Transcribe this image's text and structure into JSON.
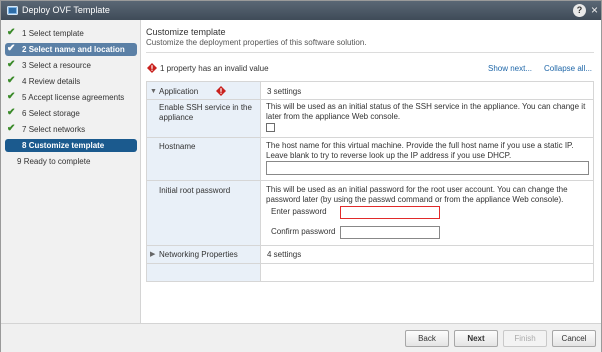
{
  "window": {
    "title": "Deploy OVF Template",
    "help_label": "?",
    "close_label": "×",
    "icon": "vm-deploy-icon"
  },
  "sidebar": {
    "steps": [
      {
        "number": "1",
        "label": "Select template",
        "completed": true
      },
      {
        "number": "2",
        "label": "Select name and location",
        "completed": true
      },
      {
        "number": "3",
        "label": "Select a resource",
        "completed": true
      },
      {
        "number": "4",
        "label": "Review details",
        "completed": true
      },
      {
        "number": "5",
        "label": "Accept license agreements",
        "completed": true
      },
      {
        "number": "6",
        "label": "Select storage",
        "completed": true
      },
      {
        "number": "7",
        "label": "Select networks",
        "completed": true
      },
      {
        "number": "8",
        "label": "Customize template",
        "completed": false
      },
      {
        "number": "9",
        "label": "Ready to complete",
        "completed": false
      }
    ],
    "check_glyph": "✔",
    "selected_step": "2",
    "current_step": "8"
  },
  "main": {
    "title": "Customize template",
    "subtitle": "Customize the deployment properties of this software solution.",
    "warning": "1 property has an invalid value",
    "show_next": "Show next...",
    "collapse_all": "Collapse all...",
    "groups": [
      {
        "label": "Application",
        "value": "3 settings",
        "expanded": true,
        "invalid": true,
        "properties": [
          {
            "label": "Enable SSH service in the appliance",
            "description": "This will be used as an initial status of the SSH service in the appliance. You can change it later from the appliance Web console.",
            "control": "checkbox"
          },
          {
            "label": "Hostname",
            "description": "The host name for this virtual machine. Provide the full host name if you use a static IP. Leave blank to try to reverse look up the IP address if you use DHCP.",
            "control": "text",
            "value": ""
          },
          {
            "label": "Initial root password",
            "description": "This will be used as an initial password for the root user account. You can change the password later (by using the passwd command or from the appliance Web console).",
            "control": "password",
            "fields": [
              {
                "label": "Enter password",
                "value": "",
                "invalid": true
              },
              {
                "label": "Confirm password",
                "value": "",
                "invalid": false
              }
            ]
          }
        ]
      },
      {
        "label": "Networking Properties",
        "value": "4 settings",
        "expanded": false,
        "invalid": false
      }
    ]
  },
  "footer": {
    "back": "Back",
    "next": "Next",
    "finish": "Finish",
    "cancel": "Cancel"
  },
  "colors": {
    "titlebar": "#4a5664",
    "sidebar_bg": "#f1f1f1",
    "selected_step": "#5b80a6",
    "current_step": "#1b5a8e",
    "link": "#1e66a8",
    "invalid": "#e02a2a",
    "check": "#3a8a29"
  }
}
